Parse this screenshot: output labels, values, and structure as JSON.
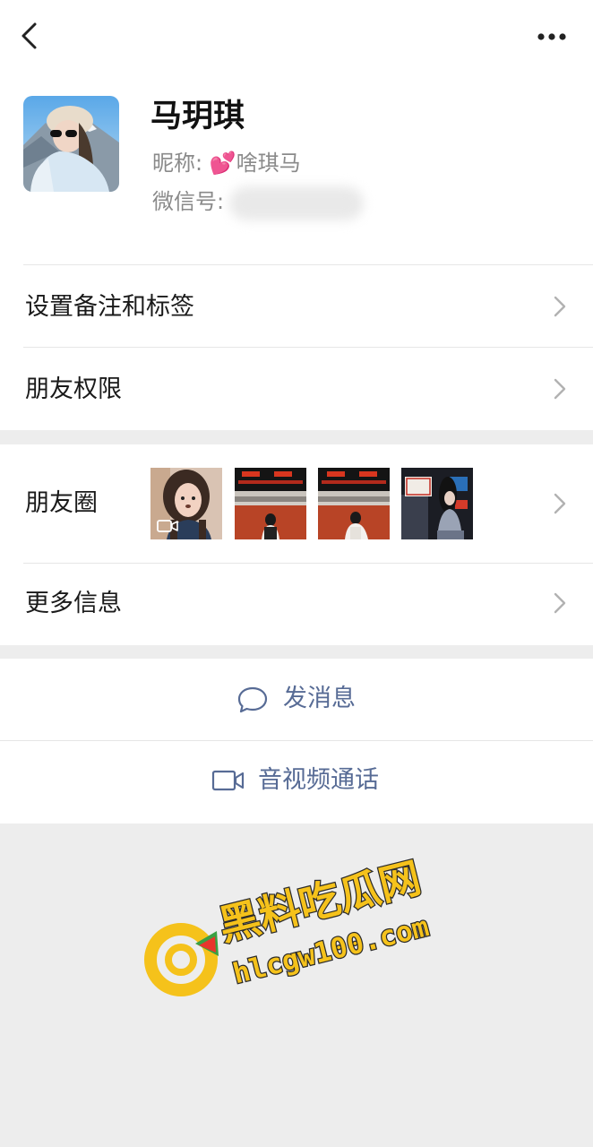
{
  "header": {
    "back_icon": "chevron-left-icon",
    "more_icon": "more-dots-icon"
  },
  "profile": {
    "name": "马玥琪",
    "nickname_label": "昵称:",
    "nickname_emoji": "💕",
    "nickname": "啥琪马",
    "wechat_id_label": "微信号:"
  },
  "menu": {
    "remark_tags": "设置备注和标签",
    "friend_permissions": "朋友权限",
    "moments": "朋友圈",
    "more_info": "更多信息"
  },
  "moments_thumbs": [
    {
      "desc": "selfie-video",
      "overlay_icon": "video-icon"
    },
    {
      "desc": "photo-red-wall"
    },
    {
      "desc": "photo-red-wall"
    },
    {
      "desc": "photo-night-sign",
      "sign_text": "我在重庆"
    }
  ],
  "actions": {
    "send_message": "发消息",
    "video_call": "音视频通话"
  },
  "watermark": {
    "title": "黑料吃瓜网",
    "url": "hlcgw100.com"
  },
  "colors": {
    "link_blue": "#576b95",
    "background": "#ededed",
    "watermark_yellow": "#f5c21b"
  }
}
